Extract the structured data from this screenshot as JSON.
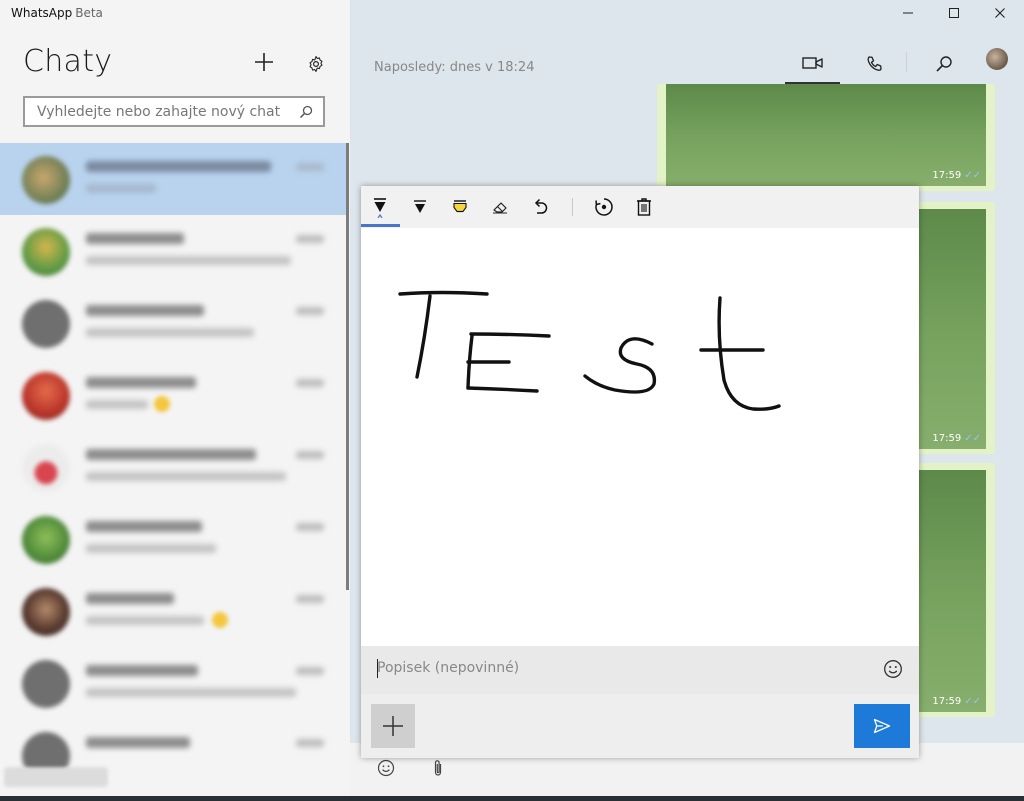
{
  "window": {
    "app_name": "WhatsApp",
    "app_tag": "Beta"
  },
  "sidebar": {
    "title": "Chaty",
    "search_placeholder": "Vyhledejte nebo zahajte nový chat"
  },
  "chat_header": {
    "status": "Naposledy: dnes v 18:24"
  },
  "messages": [
    {
      "time": "17:59"
    },
    {
      "time": "17:59"
    },
    {
      "time": "17:59"
    }
  ],
  "drawing": {
    "handwritten_text": "Test",
    "caption_placeholder": "Popisek (nepovinné)"
  },
  "colors": {
    "accent": "#1e7ad8",
    "selected_chat": "#b9d3ee",
    "highlighter": "#f5d63d",
    "image_bubble": "#e3f3c7"
  }
}
